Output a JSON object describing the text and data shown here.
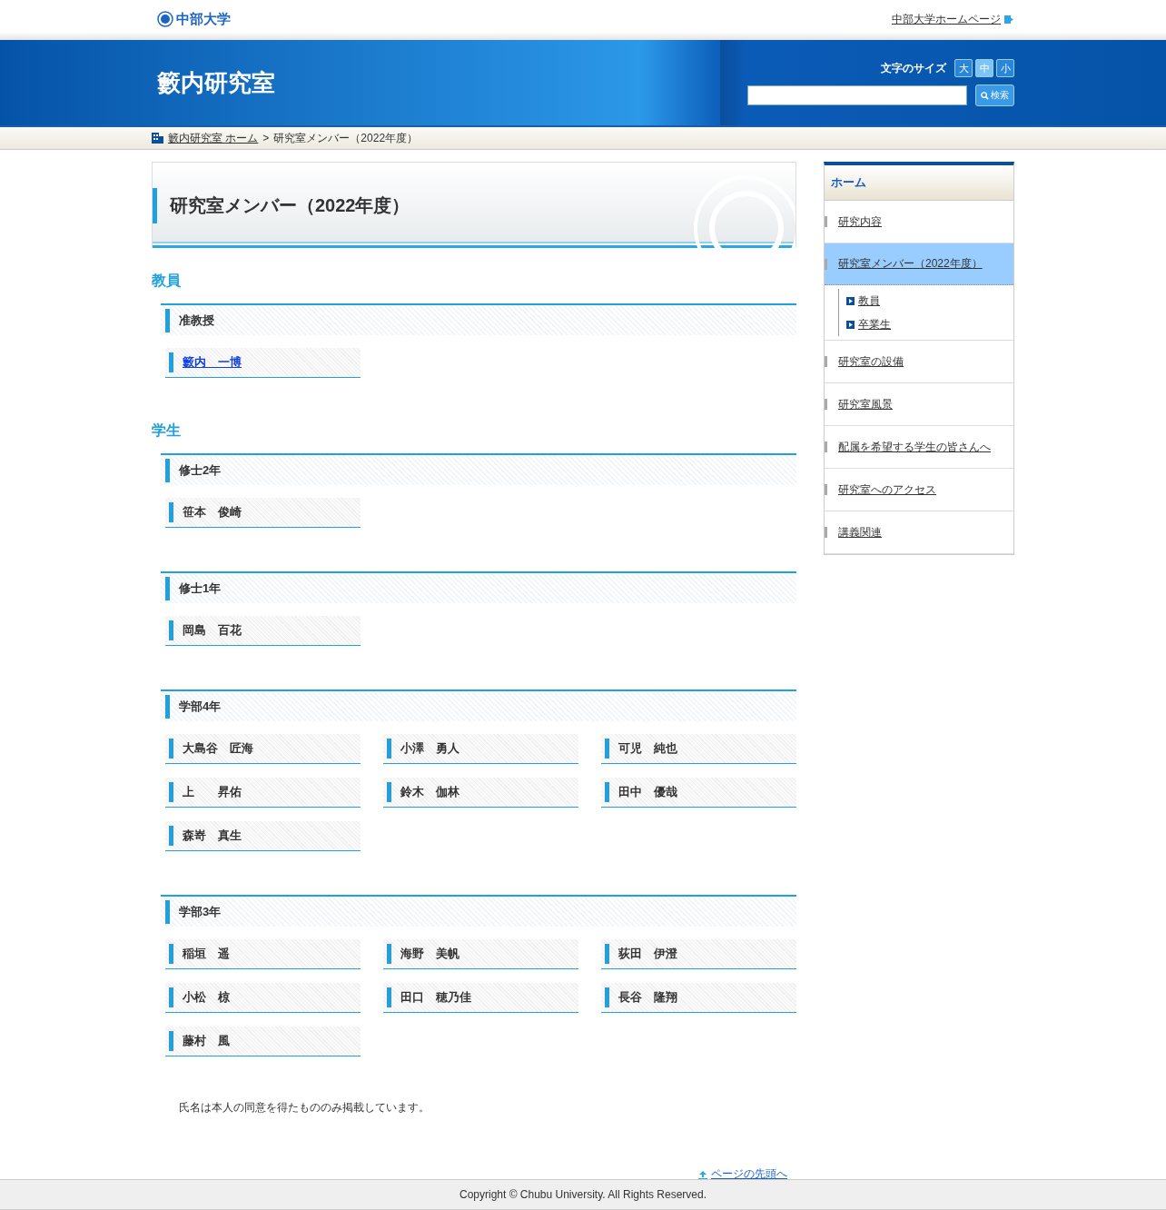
{
  "header": {
    "logo": "中部大学",
    "home_link": "中部大学ホームページ",
    "site_title": "籔内研究室",
    "font_size": {
      "label": "文字のサイズ",
      "buttons": [
        {
          "label": "大",
          "selected": false
        },
        {
          "label": "中",
          "selected": true
        },
        {
          "label": "小",
          "selected": false
        }
      ]
    },
    "search": {
      "button": "検索"
    }
  },
  "breadcrumb": {
    "home": "籔内研究室 ホーム",
    "separator": ">",
    "current": "研究室メンバー（2022年度）"
  },
  "page_title": "研究室メンバー（2022年度）",
  "sections": [
    {
      "heading": "教員",
      "groups": [
        {
          "heading": "准教授",
          "members": [
            {
              "name": "籔内　一博",
              "linked": true
            }
          ]
        }
      ]
    },
    {
      "heading": "学生",
      "groups": [
        {
          "heading": "修士2年",
          "members": [
            {
              "name": "笹本　俊崎",
              "linked": false
            }
          ]
        },
        {
          "heading": "修士1年",
          "members": [
            {
              "name": "岡島　百花",
              "linked": false
            }
          ]
        },
        {
          "heading": "学部4年",
          "members": [
            {
              "name": "大島谷　匠海",
              "linked": false
            },
            {
              "name": "小澤　勇人",
              "linked": false
            },
            {
              "name": "可児　純也",
              "linked": false
            },
            {
              "name": "上　　昇佑",
              "linked": false
            },
            {
              "name": "鈴木　伽林",
              "linked": false
            },
            {
              "name": "田中　優哉",
              "linked": false
            },
            {
              "name": "森嵜　真生",
              "linked": false
            }
          ]
        },
        {
          "heading": "学部3年",
          "members": [
            {
              "name": "稲垣　遥",
              "linked": false
            },
            {
              "name": "海野　美帆",
              "linked": false
            },
            {
              "name": "荻田　伊澄",
              "linked": false
            },
            {
              "name": "小松　椋",
              "linked": false
            },
            {
              "name": "田口　穂乃佳",
              "linked": false
            },
            {
              "name": "長谷　隆翔",
              "linked": false
            },
            {
              "name": "藤村　風",
              "linked": false
            }
          ]
        }
      ]
    }
  ],
  "note": "氏名は本人の同意を得たもののみ掲載しています。",
  "back_to_top": "ページの先頭へ",
  "sidebar": {
    "home": "ホーム",
    "items": [
      {
        "label": "研究内容",
        "selected": false
      },
      {
        "label": "研究室メンバー（2022年度）",
        "selected": true,
        "children": [
          {
            "label": "教員"
          },
          {
            "label": "卒業生"
          }
        ]
      },
      {
        "label": "研究室の設備",
        "selected": false
      },
      {
        "label": "研究室風景",
        "selected": false
      },
      {
        "label": "配属を希望する学生の皆さんへ",
        "selected": false
      },
      {
        "label": "研究室へのアクセス",
        "selected": false
      },
      {
        "label": "講義関連",
        "selected": false
      }
    ]
  },
  "footer": "Copyright © Chubu University. All Rights Reserved."
}
